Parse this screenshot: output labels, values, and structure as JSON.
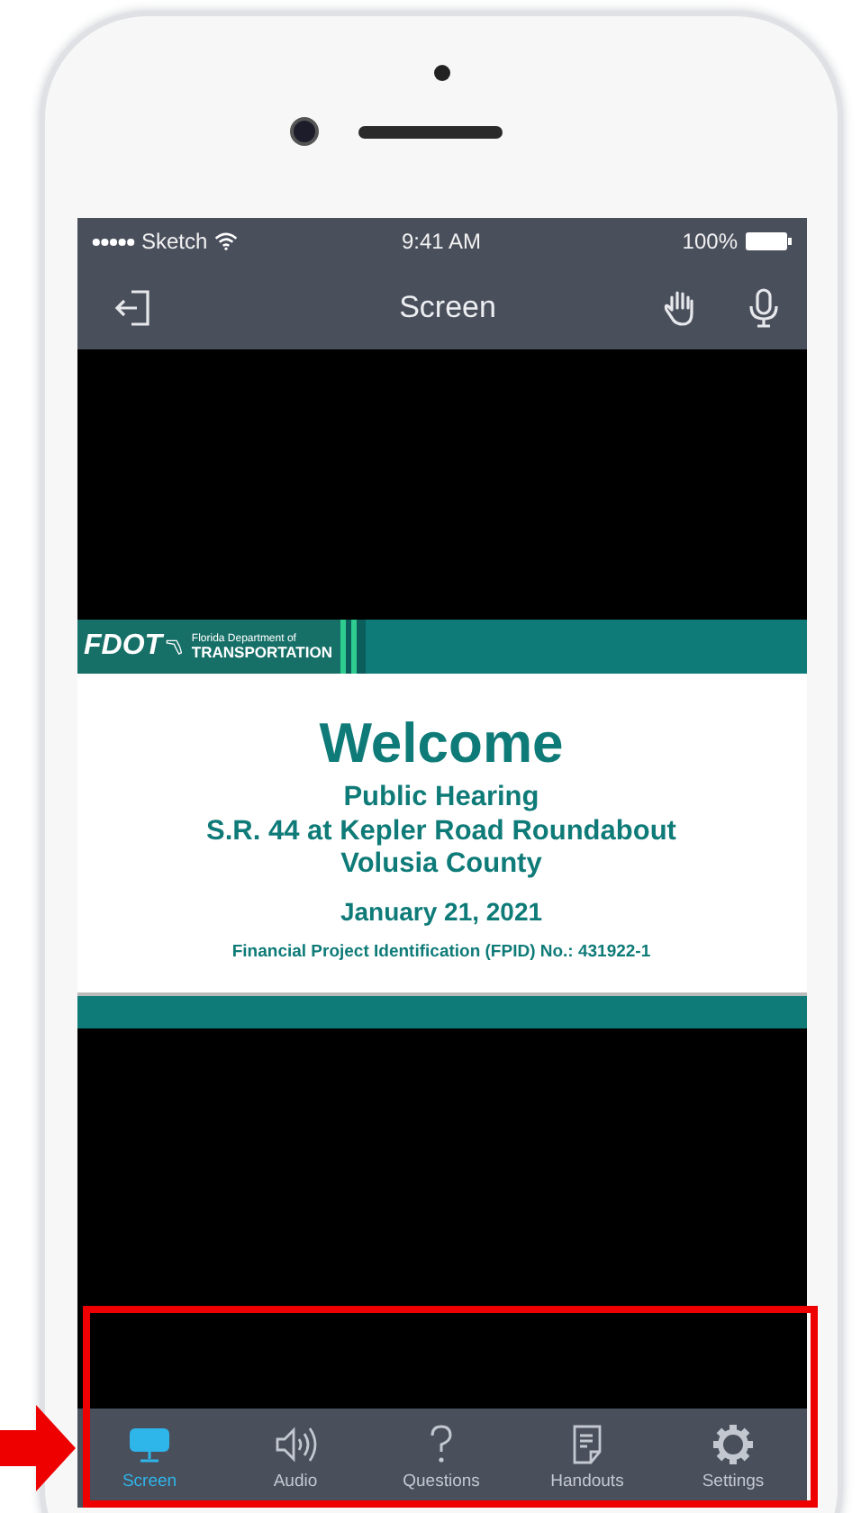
{
  "status_bar": {
    "carrier": "Sketch",
    "time": "9:41 AM",
    "battery": "100%"
  },
  "nav_bar": {
    "title": "Screen"
  },
  "slide": {
    "logo": "FDOT",
    "agency_line_1": "Florida Department of",
    "agency_line_2": "TRANSPORTATION",
    "heading": "Welcome",
    "lines": [
      "Public Hearing",
      "S.R. 44 at Kepler Road Roundabout",
      "Volusia County"
    ],
    "date": "January 21, 2021",
    "fpid": "Financial Project Identification (FPID) No.:  431922-1"
  },
  "tabs": [
    {
      "kind": "screen",
      "label": "Screen",
      "selected": true
    },
    {
      "kind": "audio",
      "label": "Audio",
      "selected": false
    },
    {
      "kind": "questions",
      "label": "Questions",
      "selected": false
    },
    {
      "kind": "handouts",
      "label": "Handouts",
      "selected": false
    },
    {
      "kind": "settings",
      "label": "Settings",
      "selected": false
    }
  ]
}
